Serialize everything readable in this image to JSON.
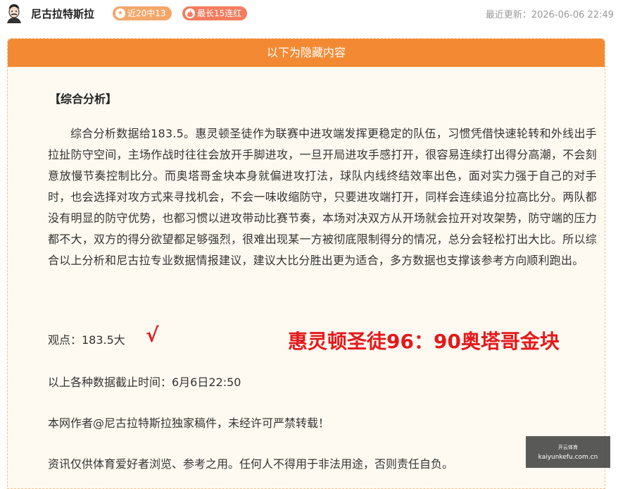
{
  "header": {
    "author": "尼古拉特斯拉",
    "badges": [
      {
        "label": "近20中13",
        "icon": "star-icon",
        "color": "#f2a86b"
      },
      {
        "label": "最长15连红",
        "icon": "fire-icon",
        "color": "#f37d5f"
      }
    ],
    "updated": "最近更新：2026-06-06 22:49"
  },
  "panel": {
    "title": "以下为隐藏内容",
    "section_title": "【综合分析】",
    "analysis": "综合分析数据给183.5。惠灵顿圣徒作为联赛中进攻端发挥更稳定的队伍，习惯凭借快速轮转和外线出手拉扯防守空间，主场作战时往往会放开手脚进攻，一旦开局进攻手感打开，很容易连续打出得分高潮，不会刻意放慢节奏控制比分。而奥塔哥金块本身就偏进攻打法，球队内线终结效率出色，面对实力强于自己的对手时，也会选择对攻方式来寻找机会，不会一味收缩防守，只要进攻端打开，同样会连续追分拉高比分。两队都没有明显的防守优势，也都习惯以进攻带动比赛节奏，本场对决双方从开场就会拉开对攻架势，防守端的压力都不大，双方的得分欲望都足够强烈，很难出现某一方被彻底限制得分的情况，总分会轻松打出大比。所以综合以上分析和尼古拉专业数据情报建议，建议大比分胜出更为适合，多方数据也支撑该参考方向顺利跑出。",
    "viewpoint": "观点：183.5大",
    "check": "√",
    "score": "惠灵顿圣徒96：90奥塔哥金块",
    "cutoff": "以上各种数据截止时间：6月6日22:50",
    "copyright": "本网作者@尼古拉特斯拉独家稿件，未经许可严禁转载！",
    "disclaimer": "资讯仅供体育爱好者浏览、参考之用。任何人不得用于非法用途，否则责任自负。"
  },
  "watermark": {
    "top": "开云体育",
    "domain": "kaiyunkefu.com.cn"
  },
  "colors": {
    "accent": "#f38a33",
    "score_red": "#e3191c"
  }
}
